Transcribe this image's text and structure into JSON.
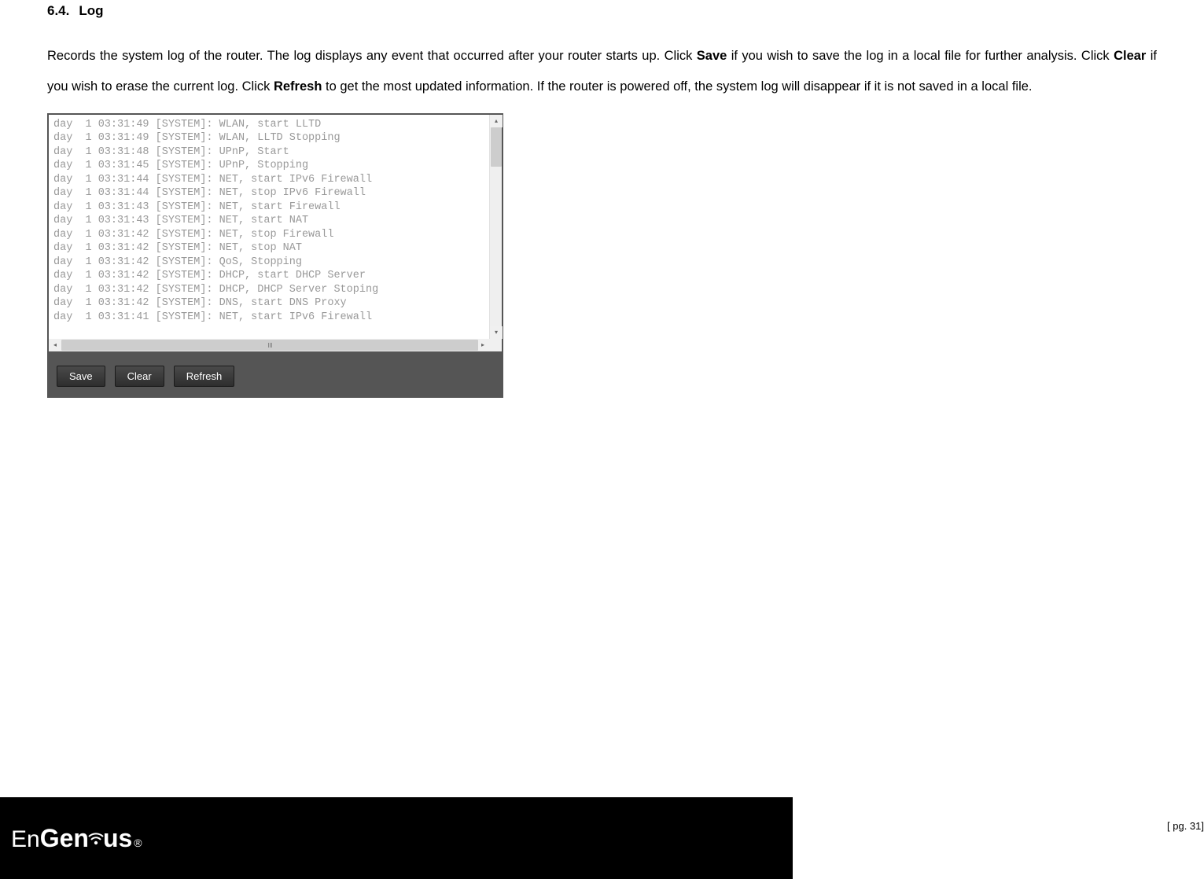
{
  "section": {
    "number": "6.4.",
    "title": "Log"
  },
  "description": {
    "part1": "Records the system log of the router. The log displays any event that occurred after your router starts up. Click ",
    "save": "Save",
    "part2": " if you wish to save the log in a local file for further analysis. Click ",
    "clear": "Clear",
    "part3": " if you wish to erase the current log. Click ",
    "refresh": "Refresh",
    "part4": " to get the most updated information. If the router is powered off, the system log will disappear if it is not saved in a local file."
  },
  "log_entries": [
    "day  1 03:31:49 [SYSTEM]: WLAN, start LLTD",
    "day  1 03:31:49 [SYSTEM]: WLAN, LLTD Stopping",
    "day  1 03:31:48 [SYSTEM]: UPnP, Start",
    "day  1 03:31:45 [SYSTEM]: UPnP, Stopping",
    "day  1 03:31:44 [SYSTEM]: NET, start IPv6 Firewall",
    "day  1 03:31:44 [SYSTEM]: NET, stop IPv6 Firewall",
    "day  1 03:31:43 [SYSTEM]: NET, start Firewall",
    "day  1 03:31:43 [SYSTEM]: NET, start NAT",
    "day  1 03:31:42 [SYSTEM]: NET, stop Firewall",
    "day  1 03:31:42 [SYSTEM]: NET, stop NAT",
    "day  1 03:31:42 [SYSTEM]: QoS, Stopping",
    "day  1 03:31:42 [SYSTEM]: DHCP, start DHCP Server",
    "day  1 03:31:42 [SYSTEM]: DHCP, DHCP Server Stoping",
    "day  1 03:31:42 [SYSTEM]: DNS, start DNS Proxy",
    "day  1 03:31:41 [SYSTEM]: NET, start IPv6 Firewall"
  ],
  "buttons": {
    "save": "Save",
    "clear": "Clear",
    "refresh": "Refresh"
  },
  "footer": {
    "logo_text1": "En",
    "logo_text2": "Gen",
    "logo_text3": "us",
    "registered": "®"
  },
  "page_number": "[ pg. 31]"
}
